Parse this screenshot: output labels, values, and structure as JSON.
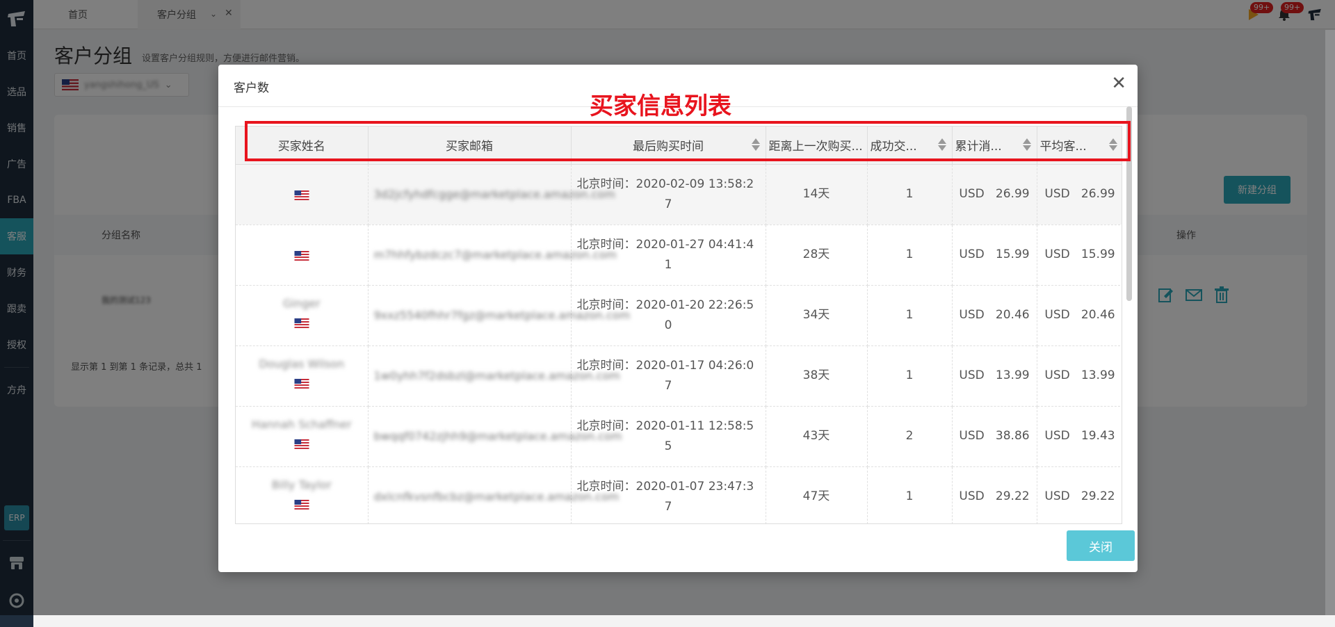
{
  "sidebar": {
    "items": [
      {
        "label": "首页"
      },
      {
        "label": "选品"
      },
      {
        "label": "销售"
      },
      {
        "label": "广告"
      },
      {
        "label": "FBA"
      },
      {
        "label": "客服"
      },
      {
        "label": "财务"
      },
      {
        "label": "跟卖"
      },
      {
        "label": "授权"
      },
      {
        "label": "方舟"
      }
    ],
    "erp_label": "ERP",
    "active": "客服"
  },
  "tabs": {
    "home": "首页",
    "group": "客户分组"
  },
  "header": {
    "badge_flag": "99+",
    "badge_bell": "99+"
  },
  "page": {
    "title": "客户分组",
    "subtitle": "设置客户分组规则，方便进行邮件营销。",
    "store_name": "yangshihong_US",
    "new_group_button": "新建分组",
    "col_group_name": "分组名称",
    "col_operation": "操作",
    "row_group_name": "我的测试123",
    "paging": "显示第 1 到第 1 条记录，总共 1"
  },
  "modal": {
    "title": "客户数",
    "annotation": "买家信息列表",
    "close_button": "关闭",
    "columns": [
      "买家姓名",
      "买家邮箱",
      "最后购买时间",
      "距离上一次购买...",
      "成功交...",
      "累计消...",
      "平均客..."
    ],
    "rows": [
      {
        "name": "",
        "email": "3d2jcfyhdfcgge@marketplace.amazon.com",
        "time_line1": "北京时间：2020-02-09 13:58:2",
        "time_line2": "7",
        "days": "14天",
        "count": "1",
        "total": "USD   26.99",
        "avg": "USD   26.99"
      },
      {
        "name": "",
        "email": "m7hhfybzdczc7@marketplace.amazon.com",
        "time_line1": "北京时间：2020-01-27 04:41:4",
        "time_line2": "1",
        "days": "28天",
        "count": "1",
        "total": "USD   15.99",
        "avg": "USD   15.99"
      },
      {
        "name": "Ginger",
        "email": "9xxz5540fhhr7fgz@marketplace.amazon.com",
        "time_line1": "北京时间：2020-01-20 22:26:5",
        "time_line2": "0",
        "days": "34天",
        "count": "1",
        "total": "USD   20.46",
        "avg": "USD   20.46"
      },
      {
        "name": "Douglas Wilson",
        "email": "1w0yhh7f2dsbzl@marketplace.amazon.com",
        "time_line1": "北京时间：2020-01-17 04:26:0",
        "time_line2": "7",
        "days": "38天",
        "count": "1",
        "total": "USD   13.99",
        "avg": "USD   13.99"
      },
      {
        "name": "Hannah Schaffner",
        "email": "bwqqf0742zjhh9@marketplace.amazon.com",
        "time_line1": "北京时间：2020-01-11 12:58:5",
        "time_line2": "5",
        "days": "43天",
        "count": "2",
        "total": "USD   38.86",
        "avg": "USD   19.43"
      },
      {
        "name": "Billy Taylor",
        "email": "dxlcnfkvsnfbcbz@marketplace.amazon.com",
        "time_line1": "北京时间：2020-01-07 23:47:3",
        "time_line2": "7",
        "days": "47天",
        "count": "1",
        "total": "USD   29.22",
        "avg": "USD   29.22"
      }
    ]
  }
}
